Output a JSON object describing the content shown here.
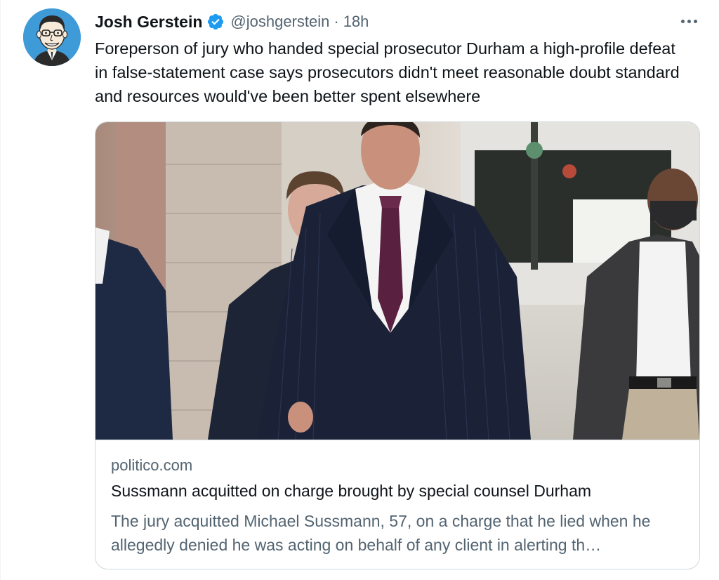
{
  "author": {
    "display_name": "Josh Gerstein",
    "handle": "@joshgerstein",
    "separator": "·",
    "timestamp": "18h",
    "verified": true,
    "avatar_icon": "caricature-avatar"
  },
  "tweet": {
    "text": "Foreperson of jury who handed special prosecutor Durham a high-profile defeat in false-statement case says prosecutors didn't meet reasonable doubt standard and resources would've been better spent elsewhere"
  },
  "card": {
    "domain": "politico.com",
    "title": "Sussmann acquitted on charge brought by special counsel Durham",
    "description": "The jury acquitted Michael Sussmann, 57, on a charge that he lied when he allegedly denied he was acting on behalf of any client in alerting th…",
    "image_icon": "news-photo"
  },
  "icons": {
    "verified": "verified-badge-icon",
    "more": "more-options-icon"
  },
  "colors": {
    "accent": "#1d9bf0",
    "text_primary": "#0f1419",
    "text_secondary": "#536471",
    "border": "#cfd9de",
    "avatar_bg": "#3f9ad8"
  }
}
